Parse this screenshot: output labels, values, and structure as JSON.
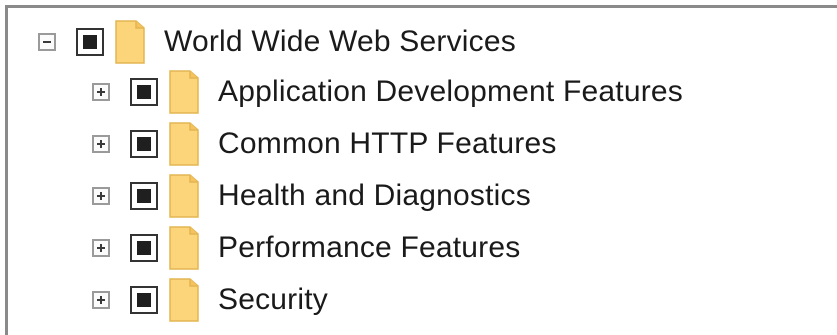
{
  "tree": {
    "root": {
      "label": "World Wide Web Services",
      "expander": "collapse",
      "check_state": "partial",
      "icon": "folder-icon"
    },
    "children": [
      {
        "label": "Application Development Features",
        "expander": "expand",
        "check_state": "partial",
        "icon": "folder-icon"
      },
      {
        "label": "Common HTTP Features",
        "expander": "expand",
        "check_state": "partial",
        "icon": "folder-icon"
      },
      {
        "label": "Health and Diagnostics",
        "expander": "expand",
        "check_state": "partial",
        "icon": "folder-icon"
      },
      {
        "label": "Performance Features",
        "expander": "expand",
        "check_state": "partial",
        "icon": "folder-icon"
      },
      {
        "label": "Security",
        "expander": "expand",
        "check_state": "partial",
        "icon": "folder-icon"
      }
    ]
  },
  "colors": {
    "folder_fill": "#fcd47a",
    "folder_edge": "#e3b552",
    "frame_border": "#8a8a8a",
    "check_fill": "#1f1f1f"
  }
}
